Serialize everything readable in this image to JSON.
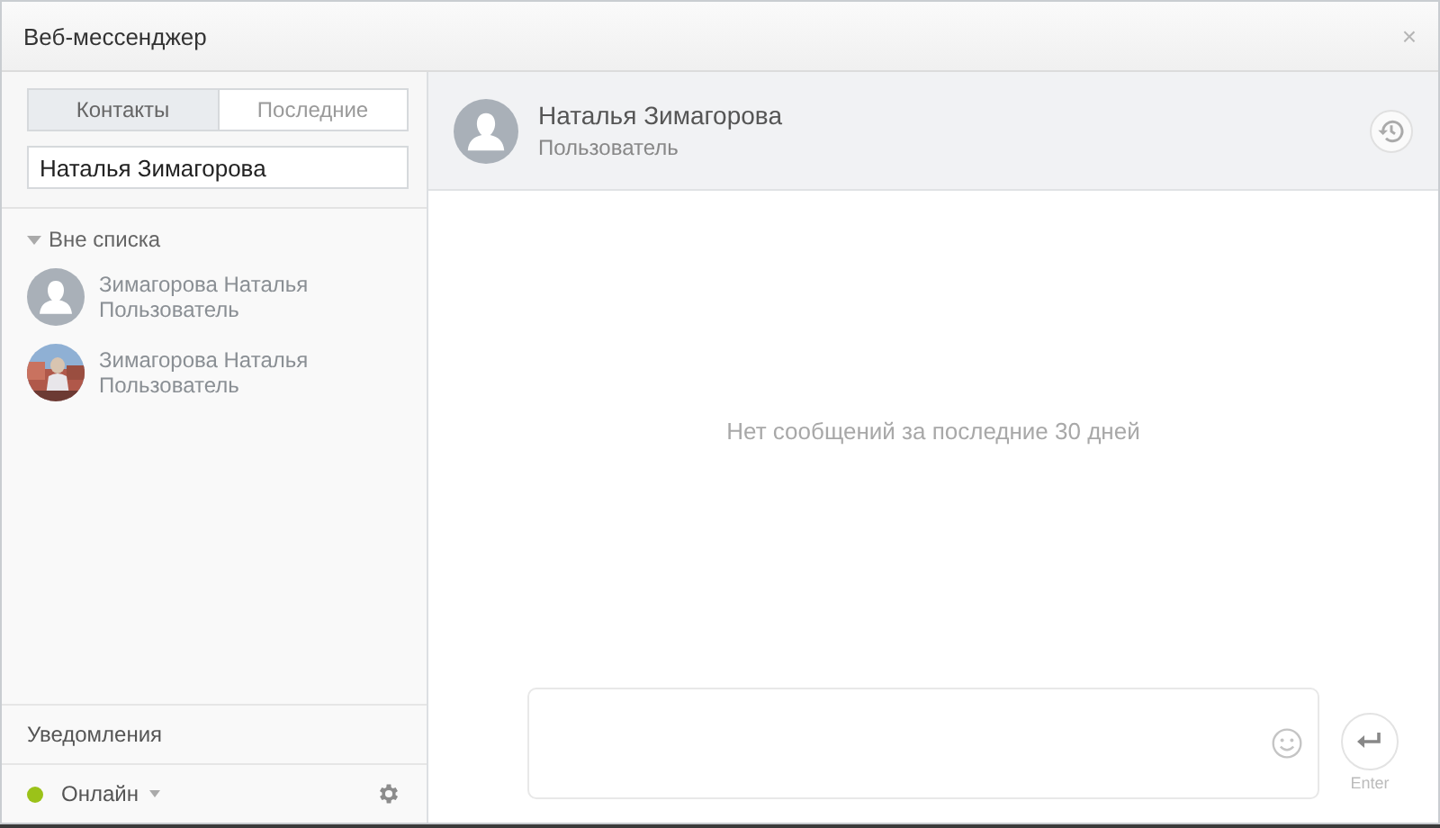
{
  "window": {
    "title": "Веб-мессенджер",
    "close": "×"
  },
  "tabs": [
    {
      "label": "Контакты",
      "selected": true
    },
    {
      "label": "Последние",
      "selected": false
    }
  ],
  "search": {
    "value": "Наталья Зимагорова"
  },
  "group": {
    "label": "Вне списка",
    "expanded": true
  },
  "contacts": [
    {
      "name": "Зимагорова Наталья",
      "role": "Пользователь",
      "kind": "default"
    },
    {
      "name": "Зимагорова Наталья",
      "role": "Пользователь"
    }
  ],
  "notifications": "Уведомления",
  "status": {
    "label": "Онлайн",
    "color": "#9bc219"
  },
  "chat": {
    "name": "Наталья Зимагорова",
    "role": "Пользователь",
    "empty": "Нет сообщений за последние 30 дней"
  },
  "send": {
    "label": "Enter"
  }
}
